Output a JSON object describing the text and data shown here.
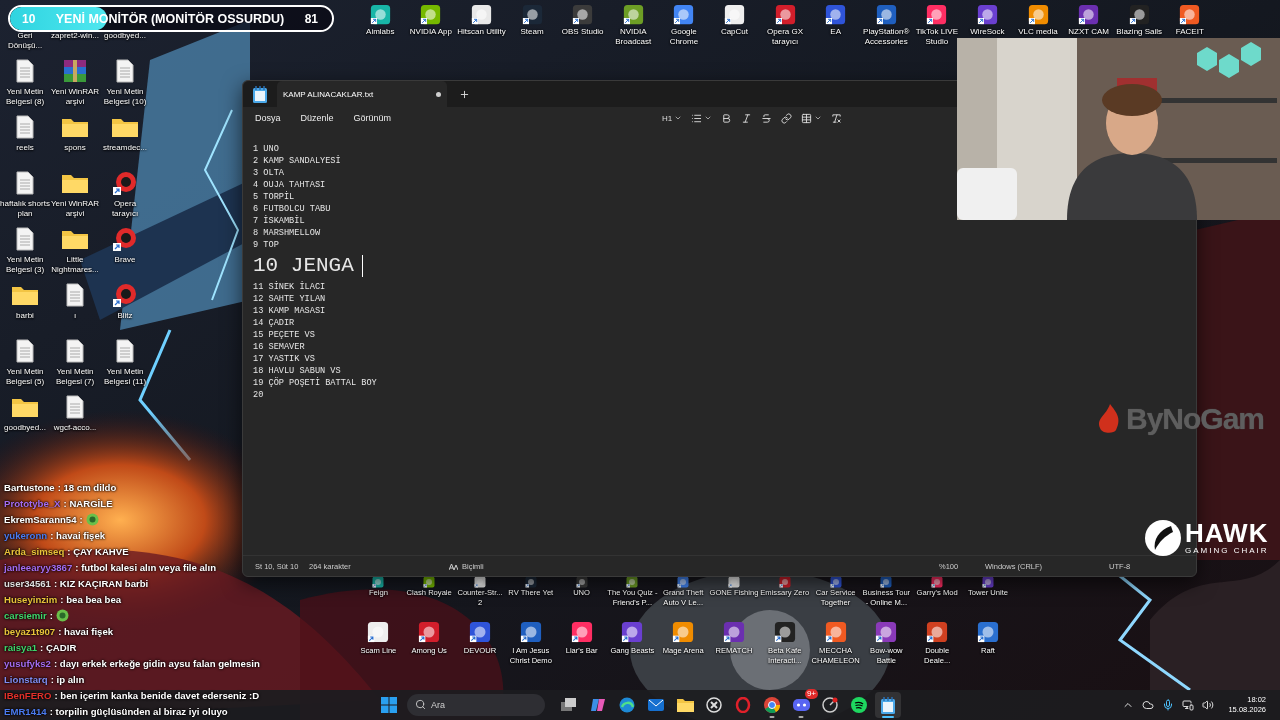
{
  "poll": {
    "left_count": "10",
    "title": "YENİ MONİTÖR (MONİTÖR OSSURDU)",
    "right_count": "81",
    "level": 0.3
  },
  "desktop_left": [
    {
      "label": "Geri Dönüşü...",
      "kind": "none"
    },
    {
      "label": "zapret2-win...",
      "kind": "none"
    },
    {
      "label": "goodbyed...",
      "kind": "none"
    },
    {
      "label": "Yeni Metin Belgesi (8)",
      "kind": "file"
    },
    {
      "label": "Yeni WinRAR arşivi",
      "kind": "archive"
    },
    {
      "label": "Yeni Metin Belgesi (10)",
      "kind": "file"
    },
    {
      "label": "reels",
      "kind": "file"
    },
    {
      "label": "spons",
      "kind": "folder"
    },
    {
      "label": "streamdec...",
      "kind": "folder"
    },
    {
      "label": "haftalık shorts plan",
      "kind": "file"
    },
    {
      "label": "Yeni WinRAR arşivi",
      "kind": "folder"
    },
    {
      "label": "Opera tarayıcı",
      "kind": "app"
    },
    {
      "label": "Yeni Metin Belgesi (3)",
      "kind": "file"
    },
    {
      "label": "Little Nightmares...",
      "kind": "folder"
    },
    {
      "label": "Brave",
      "kind": "app"
    },
    {
      "label": "barbi",
      "kind": "folder"
    },
    {
      "label": "ı",
      "kind": "file"
    },
    {
      "label": "Blitz",
      "kind": "app"
    },
    {
      "label": "Yeni Metin Belgesi (5)",
      "kind": "file"
    },
    {
      "label": "Yeni Metin Belgesi (7)",
      "kind": "file"
    },
    {
      "label": "Yeni Metin Belgesi (11)",
      "kind": "file"
    },
    {
      "label": "goodbyed...",
      "kind": "folder"
    },
    {
      "label": "wgcf-acco...",
      "kind": "file"
    }
  ],
  "desktop_top": [
    "Aimlabs",
    "NVIDIA App",
    "Hitscan Utility",
    "Steam",
    "OBS Studio",
    "NVIDIA Broadcast",
    "Google Chrome",
    "CapCut",
    "Opera GX tarayıcı",
    "EA",
    "PlayStation® Accessories",
    "TikTok LIVE Studio",
    "WireSock",
    "VLC media",
    "NZXT CAM",
    "Blazing Sails",
    "FACEIT"
  ],
  "notepad": {
    "tab_title": "KAMP ALINACAKLAR.txt",
    "unsaved": true,
    "menu": [
      "Dosya",
      "Düzenle",
      "Görünüm"
    ],
    "heading_select": "H1",
    "lines": [
      {
        "text": "1 UNO",
        "kind": "text"
      },
      {
        "text": "2 KAMP SANDALYESİ",
        "kind": "text"
      },
      {
        "text": "3 OLTA",
        "kind": "text"
      },
      {
        "text": "4 OUJA TAHTASI",
        "kind": "text"
      },
      {
        "text": "5 TORPİL",
        "kind": "text"
      },
      {
        "text": "6 FUTBOLCU TABU",
        "kind": "text"
      },
      {
        "text": "7 İSKAMBİL",
        "kind": "text"
      },
      {
        "text": "8 MARSHMELLOW",
        "kind": "text"
      },
      {
        "text": "9 TOP",
        "kind": "text"
      },
      {
        "text": "10 JENGA",
        "kind": "heading"
      },
      {
        "text": "11 SİNEK İLACI",
        "kind": "text"
      },
      {
        "text": "12 SAHTE YILAN",
        "kind": "text"
      },
      {
        "text": "13 KAMP MASASI",
        "kind": "text"
      },
      {
        "text": "14 ÇADIR",
        "kind": "text"
      },
      {
        "text": "15 PEÇETE VS",
        "kind": "text"
      },
      {
        "text": "16 SEMAVER",
        "kind": "text"
      },
      {
        "text": "17 YASTIK VS",
        "kind": "text"
      },
      {
        "text": "18 HAVLU SABUN VS",
        "kind": "text"
      },
      {
        "text": "19 ÇÖP POŞETİ BATTAL BOY",
        "kind": "text"
      },
      {
        "text": "20",
        "kind": "text"
      }
    ],
    "status": {
      "position": "St 10, Süt 10",
      "characters": "264 karakter",
      "format": "Biçimli",
      "zoom": "%100",
      "line_ending": "Windows (CRLF)",
      "encoding": "UTF-8"
    }
  },
  "games": [
    [
      "Feign",
      "Clash Royale",
      "Counter-Str... 2",
      "RV There Yet",
      "UNO",
      "The You Quiz - Friend's P...",
      "Grand Theft Auto V Le...",
      "GONE Fishing",
      "Emissary Zero",
      "Car Service Together",
      "Business Tour - Online M...",
      "Garry's Mod",
      "Tower Unite"
    ],
    [
      "Scam Line",
      "Among Us",
      "DEVOUR",
      "I Am Jesus Christ Demo",
      "Liar's Bar",
      "Gang Beasts",
      "Mage Arena",
      "REMATCH",
      "Beta Kafe Interacti...",
      "MECCHA CHAMELEON",
      "Bow-wow Battle",
      "Double Deale...",
      "Raft"
    ]
  ],
  "chat": [
    {
      "user": "Bartustone",
      "text": ": 18 cm dildo",
      "color": "#ffffff",
      "emote": false
    },
    {
      "user": "Prototybe_X",
      "text": ": NARGİLE",
      "color": "#a46cf0",
      "emote": false
    },
    {
      "user": "EkremSarann54",
      "text": ":",
      "color": "#ffffff",
      "emote": true
    },
    {
      "user": "yukeronn",
      "text": ": havai fişek",
      "color": "#4b7bf0",
      "emote": false
    },
    {
      "user": "Arda_simseq",
      "text": ": ÇAY KAHVE",
      "color": "#e8c33a",
      "emote": false
    },
    {
      "user": "janleearyy3867",
      "text": ": futbol kalesi alın veya file alın",
      "color": "#a46cf0",
      "emote": false
    },
    {
      "user": "user34561",
      "text": ": KIZ KAÇIRAN barbi",
      "color": "#e0e0e0",
      "emote": false
    },
    {
      "user": "Huseyinzim",
      "text": ": bea bea bea",
      "color": "#e8c33a",
      "emote": false
    },
    {
      "user": "carsiemir",
      "text": ":",
      "color": "#3fd46a",
      "emote": true
    },
    {
      "user": "beyaz1t907",
      "text": ": havai fişek",
      "color": "#e8c33a",
      "emote": false
    },
    {
      "user": "raisya1",
      "text": ": ÇADIR",
      "color": "#3fd46a",
      "emote": false
    },
    {
      "user": "yusufyks2",
      "text": ": dayı erkek erkeğe gidin aysu falan gelmesin",
      "color": "#a46cf0",
      "emote": false
    },
    {
      "user": "Lionstarq",
      "text": ": ip alın",
      "color": "#7f8cf0",
      "emote": false
    },
    {
      "user": "IBenFERO",
      "text": ": ben içerim kanka benide davet ederseniz :D",
      "color": "#e0302a",
      "emote": false
    },
    {
      "user": "EMR1414",
      "text": ": torpilin güçlüsünden al biraz iyi oluyo",
      "color": "#4b7bf0",
      "emote": false
    }
  ],
  "sponsor_logo": "ByNoGam",
  "chair_logo": {
    "name": "HAWK",
    "tagline": "GAMING CHAIR"
  },
  "taskbar": {
    "search_placeholder": "Ara",
    "time": "18:02",
    "date": "15.08.2026",
    "apps": [
      {
        "kind": "start",
        "running": false,
        "selected": false
      },
      {
        "kind": "taskview",
        "running": false,
        "selected": false
      },
      {
        "kind": "copilot",
        "running": false,
        "selected": false
      },
      {
        "kind": "wave",
        "running": false,
        "selected": false
      },
      {
        "kind": "mail",
        "running": false,
        "selected": false
      },
      {
        "kind": "folder",
        "running": false,
        "selected": false
      },
      {
        "kind": "xmark",
        "running": false,
        "selected": false
      },
      {
        "kind": "ring",
        "running": false,
        "selected": false
      },
      {
        "kind": "chrome",
        "running": true,
        "selected": false
      },
      {
        "kind": "chat",
        "running": true,
        "selected": false,
        "badge": "9+"
      },
      {
        "kind": "steam",
        "running": false,
        "selected": false
      },
      {
        "kind": "music",
        "running": false,
        "selected": false
      },
      {
        "kind": "notepad",
        "running": true,
        "selected": true
      }
    ]
  }
}
